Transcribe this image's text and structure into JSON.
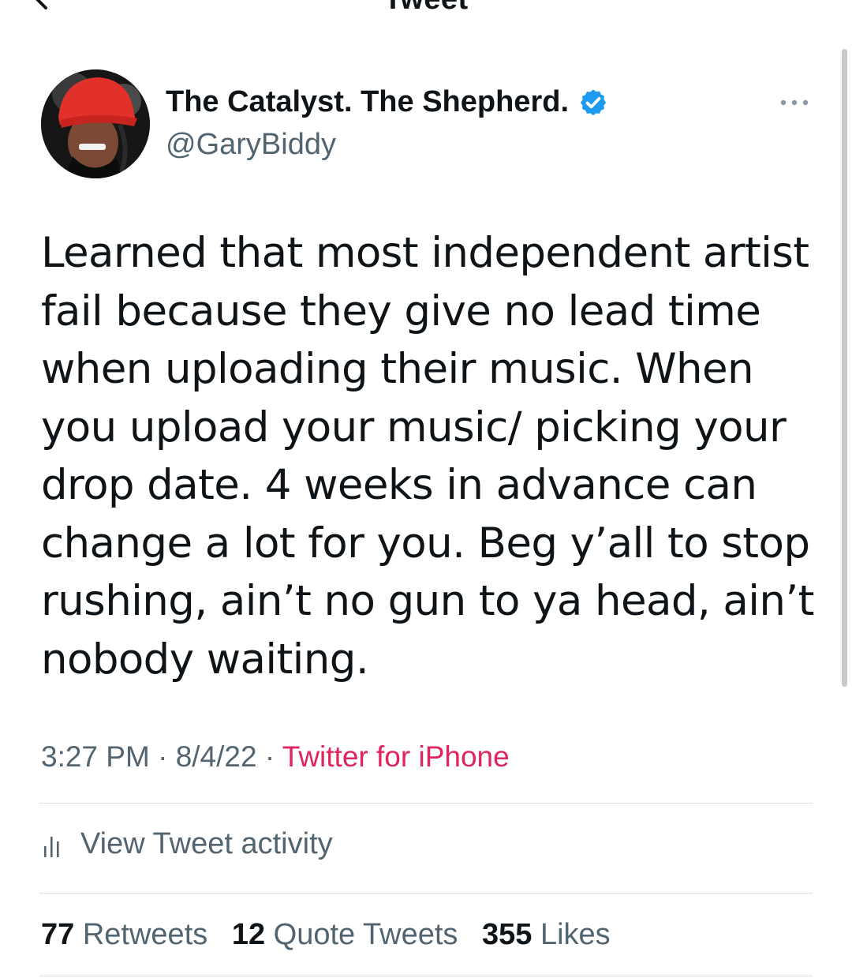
{
  "header": {
    "title": "Tweet"
  },
  "author": {
    "display_name": "The Catalyst. The Shepherd.",
    "handle": "@GaryBiddy"
  },
  "tweet": {
    "text": "Learned that most independent artist fail because they give no lead time when uploading their music. When you upload your music/ picking your drop date. 4 weeks in advance can change a lot for you. Beg y’all to stop rushing, ain’t no gun to ya head, ain’t nobody waiting."
  },
  "meta": {
    "time": "3:27 PM",
    "sep1": " · ",
    "date": "8/4/22",
    "sep2": " · ",
    "source": "Twitter for iPhone"
  },
  "activity": {
    "label": "View Tweet activity"
  },
  "stats": {
    "retweets_count": "77",
    "retweets_label": "Retweets",
    "quotes_count": "12",
    "quotes_label": "Quote Tweets",
    "likes_count": "355",
    "likes_label": "Likes"
  },
  "colors": {
    "verified": "#1d9bf0",
    "source_link": "#e0245e",
    "secondary_text": "#536471",
    "primary_text": "#0f1419"
  },
  "icons": {
    "back": "back-arrow-icon",
    "verified": "verified-badge-icon",
    "more": "more-options-icon",
    "activity": "analytics-bars-icon"
  }
}
